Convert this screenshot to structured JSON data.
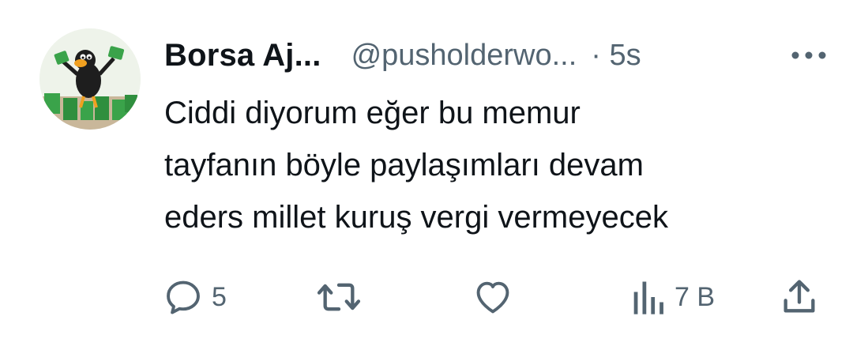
{
  "author": {
    "display_name": "Borsa Aj...",
    "handle": "@pusholderwo...",
    "time": "· 5s",
    "avatar_icon": "duck-holding-cash-avatar"
  },
  "tweet": {
    "text": "Ciddi diyorum eğer bu memur\ntayfanın böyle paylaşımları devam\neders millet kuruş vergi vermeyecek"
  },
  "actions": {
    "reply_count": "5",
    "retweet_count": "",
    "like_count": "",
    "views_count": "7 B"
  },
  "colors": {
    "text_primary": "#0f1419",
    "text_secondary": "#536471",
    "background": "#ffffff"
  }
}
